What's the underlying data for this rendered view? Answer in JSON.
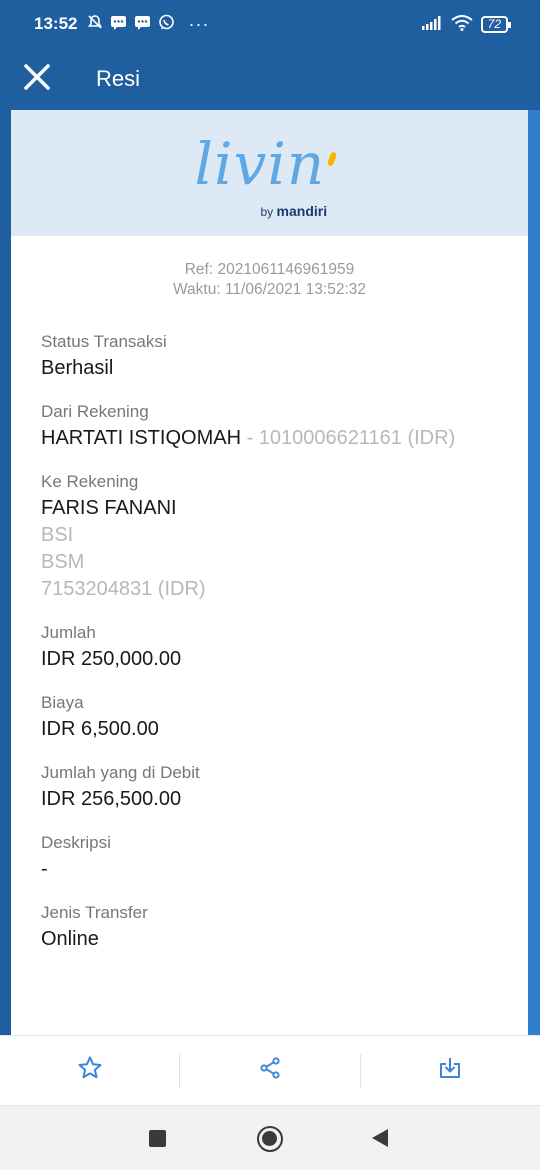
{
  "status_bar": {
    "time": "13:52",
    "battery": "72",
    "left_icons": [
      "bell-off-icon",
      "message-icon",
      "message-icon",
      "whatsapp-icon",
      "more-dots-icon"
    ],
    "right_icons": [
      "signal-icon",
      "wifi-icon",
      "battery-icon"
    ]
  },
  "app_bar": {
    "title": "Resi",
    "close_icon": "close-icon"
  },
  "logo": {
    "word": "livin",
    "by": "by",
    "brand": "mandiri"
  },
  "receipt": {
    "ref": "Ref: 2021061146961959",
    "time": "Waktu: 11/06/2021 13:52:32",
    "status": {
      "label": "Status Transaksi",
      "value": "Berhasil"
    },
    "from": {
      "label": "Dari Rekening",
      "name": "HARTATI ISTIQOMAH",
      "account": " - 1010006621161 (IDR)"
    },
    "to": {
      "label": "Ke Rekening",
      "name": "FARIS FANANI",
      "bank1": "BSI",
      "bank2": "BSM",
      "account": "7153204831 (IDR)"
    },
    "amount": {
      "label": "Jumlah",
      "value": "IDR 250,000.00"
    },
    "fee": {
      "label": "Biaya",
      "value": "IDR 6,500.00"
    },
    "debited": {
      "label": "Jumlah yang di Debit",
      "value": "IDR 256,500.00"
    },
    "description": {
      "label": "Deskripsi",
      "value": "-"
    },
    "transfer_type": {
      "label": "Jenis Transfer",
      "value": "Online"
    }
  },
  "actions": [
    "star-icon",
    "share-icon",
    "download-icon"
  ],
  "colors": {
    "brand_blue": "#1f5fa0",
    "accent_blue": "#3d86d6",
    "header_bg": "#dde9f5"
  }
}
